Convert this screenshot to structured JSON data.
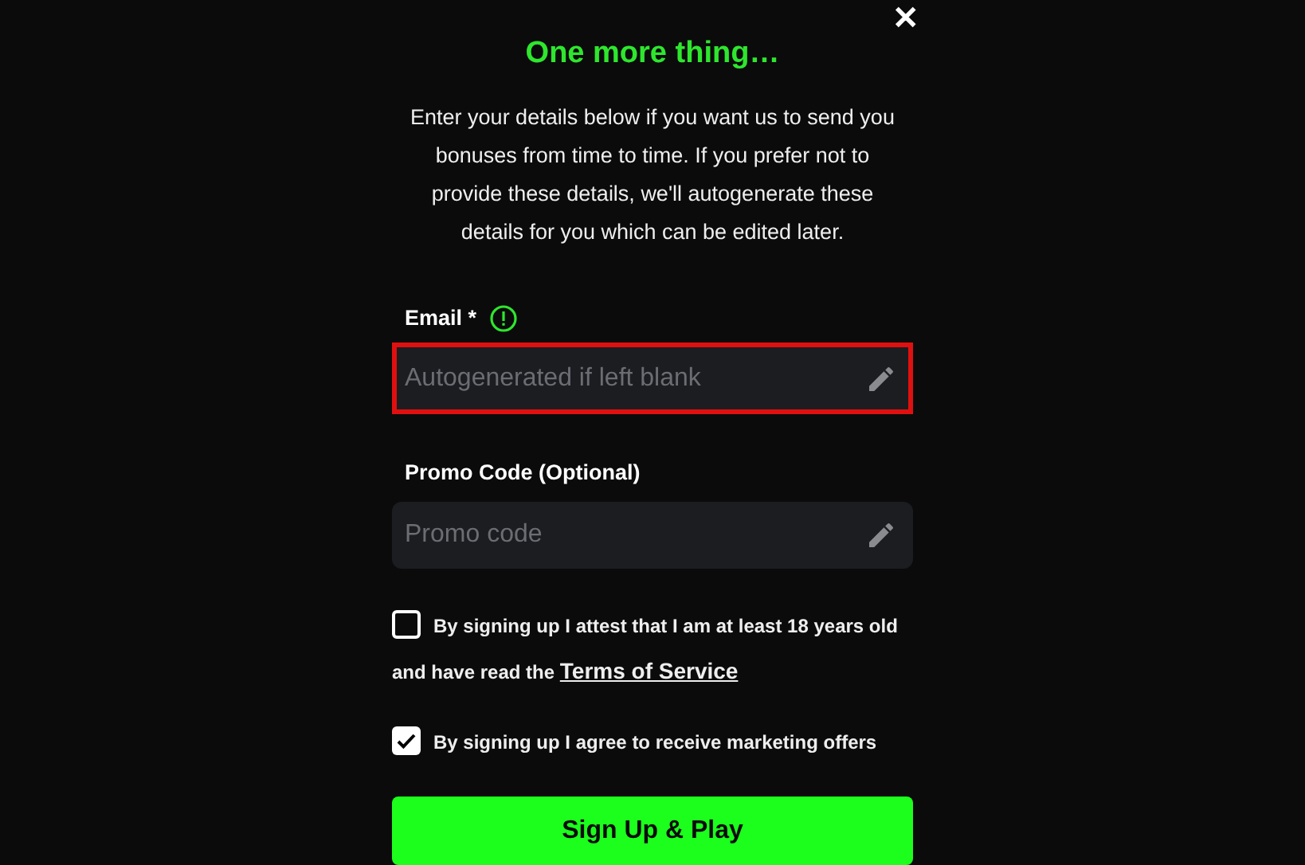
{
  "close_label": "✕",
  "title": "One more thing…",
  "intro": "Enter your details below if you want us to send you bonuses from time to time. If you prefer not to provide these details, we'll autogenerate these details for you which can be edited later.",
  "fields": [
    {
      "label": "Email *",
      "alert": true,
      "placeholder": "Autogenerated if left blank",
      "highlighted": true
    },
    {
      "label": "Promo Code (Optional)",
      "alert": false,
      "placeholder": "Promo code",
      "highlighted": false
    }
  ],
  "consents": [
    {
      "text": "By signing up I attest that I am at least 18 years old and have read the",
      "link": "Terms of Service",
      "checked": false
    },
    {
      "text": "By signing up I agree to receive marketing offers",
      "checked": true
    }
  ],
  "submit": "Sign Up & Play"
}
